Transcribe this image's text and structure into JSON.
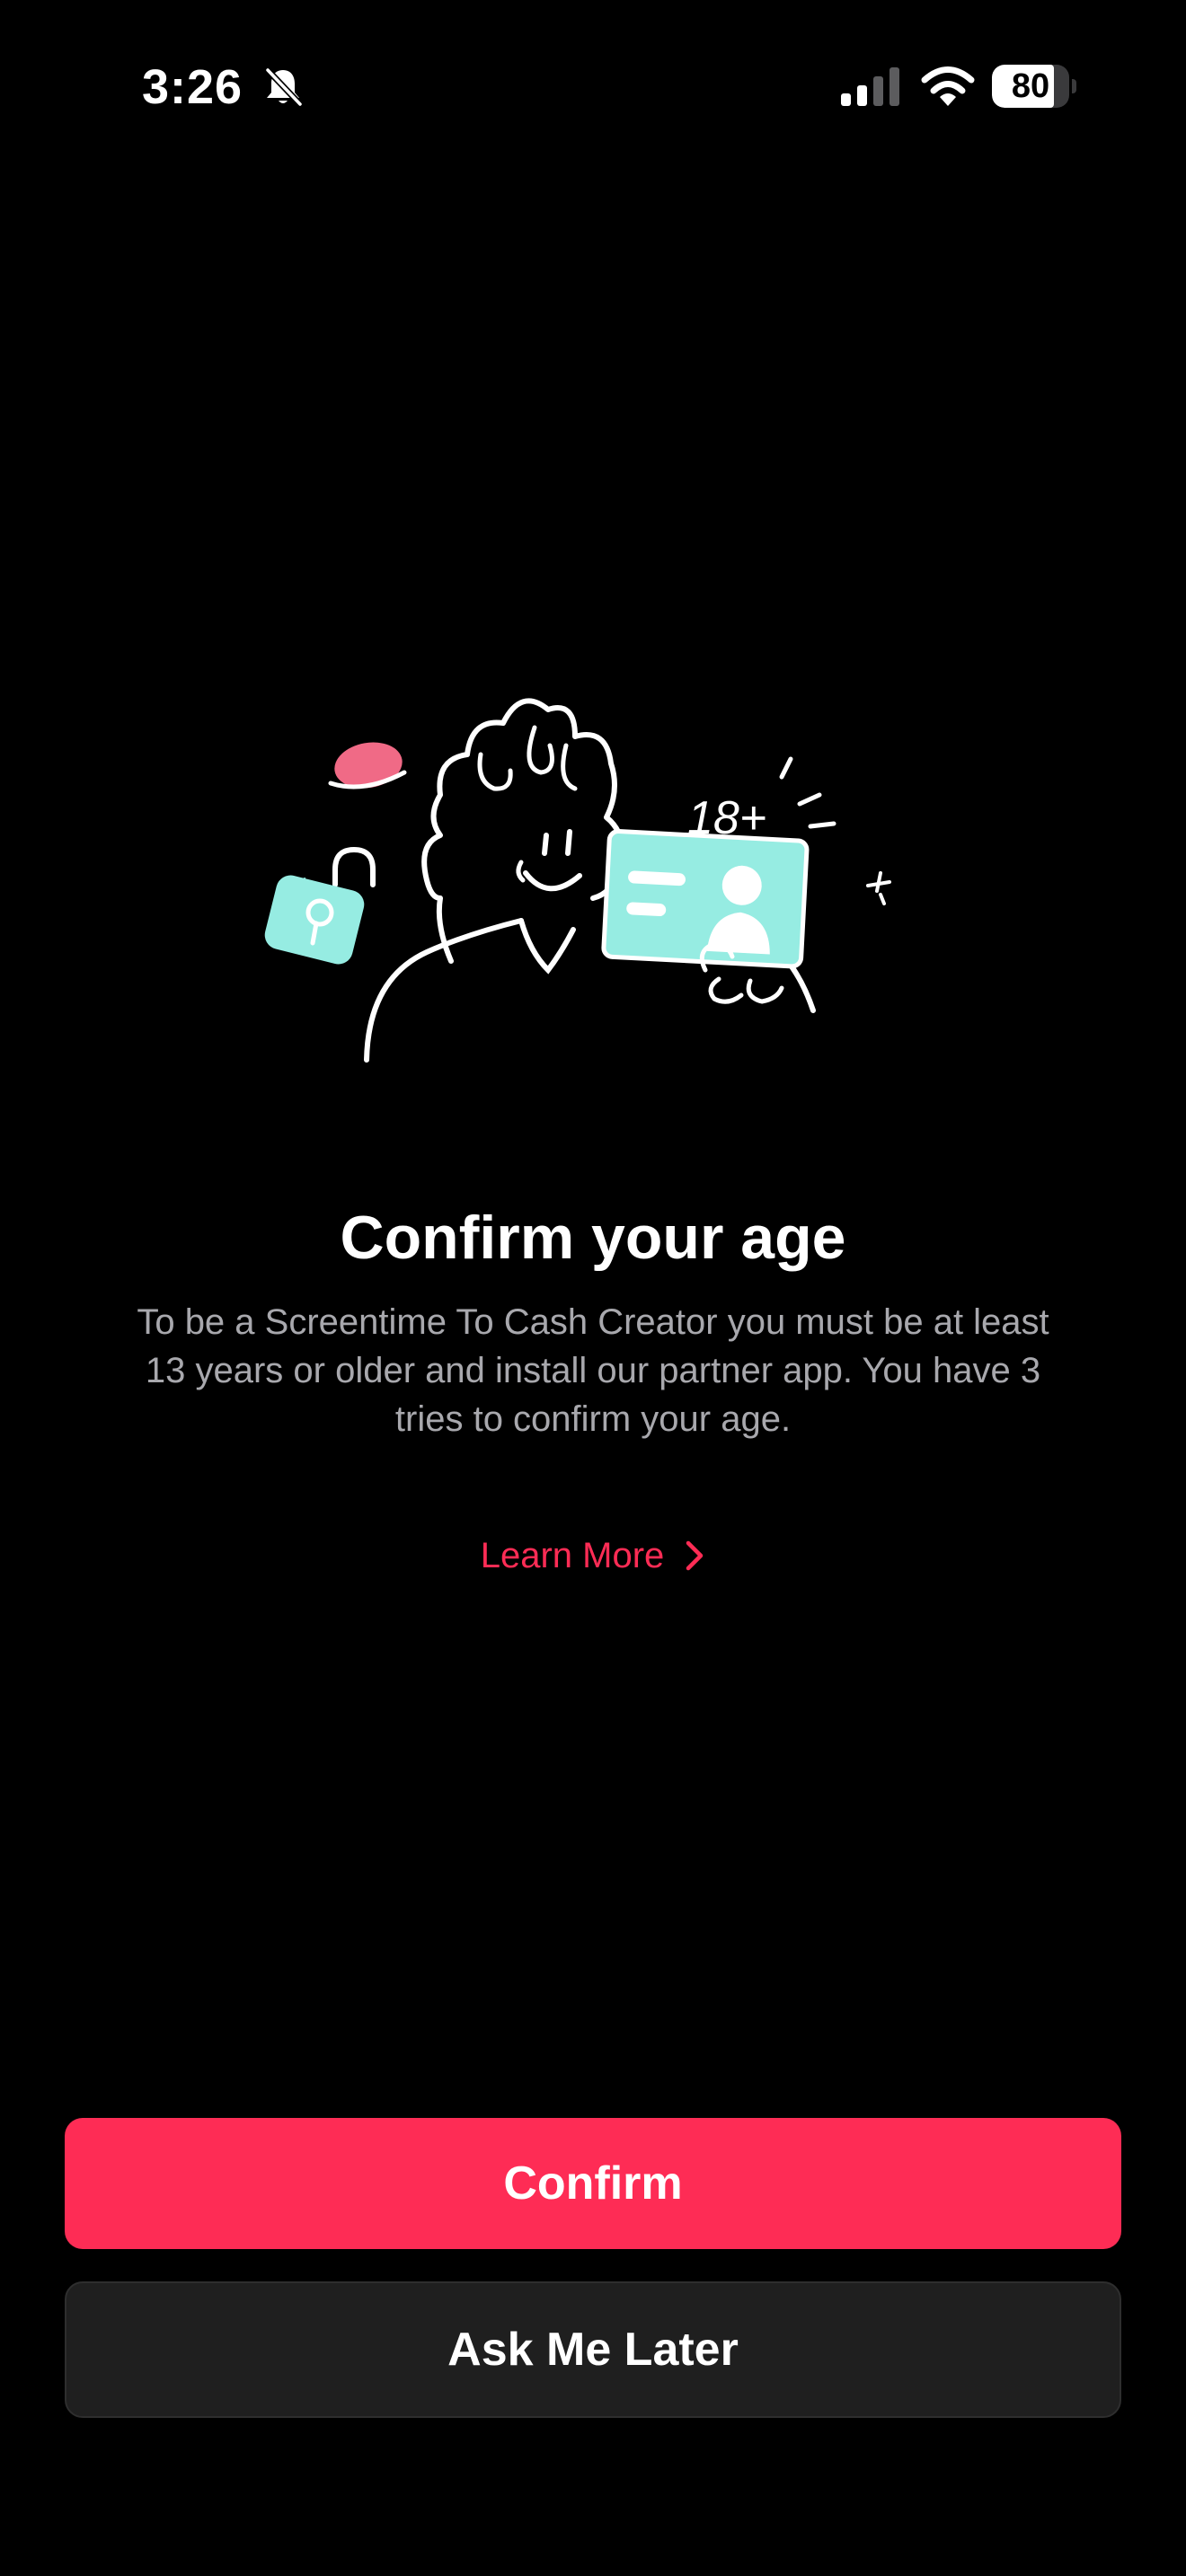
{
  "status_bar": {
    "time": "3:26",
    "battery_level": "80",
    "battery_fraction": 0.8,
    "icons": [
      "bell-slash-icon",
      "cellular-signal-icon",
      "wifi-icon",
      "battery-icon"
    ]
  },
  "illustration": {
    "label": "18+",
    "icon": "age-verification-illustration"
  },
  "content": {
    "title": "Confirm your age",
    "description": "To be a Screentime To Cash Creator you must be at least 13 years or older and install our partner app. You have 3 tries to confirm your age.",
    "learn_more": "Learn More"
  },
  "buttons": {
    "confirm": "Confirm",
    "ask_later": "Ask Me Later"
  },
  "colors": {
    "background": "#000000",
    "accent": "#fe2c55",
    "secondary_button": "#1f1f1f",
    "illustration_teal": "#96ece2",
    "illustration_pink": "#f06a86",
    "description_text": "#a8a8ad"
  }
}
